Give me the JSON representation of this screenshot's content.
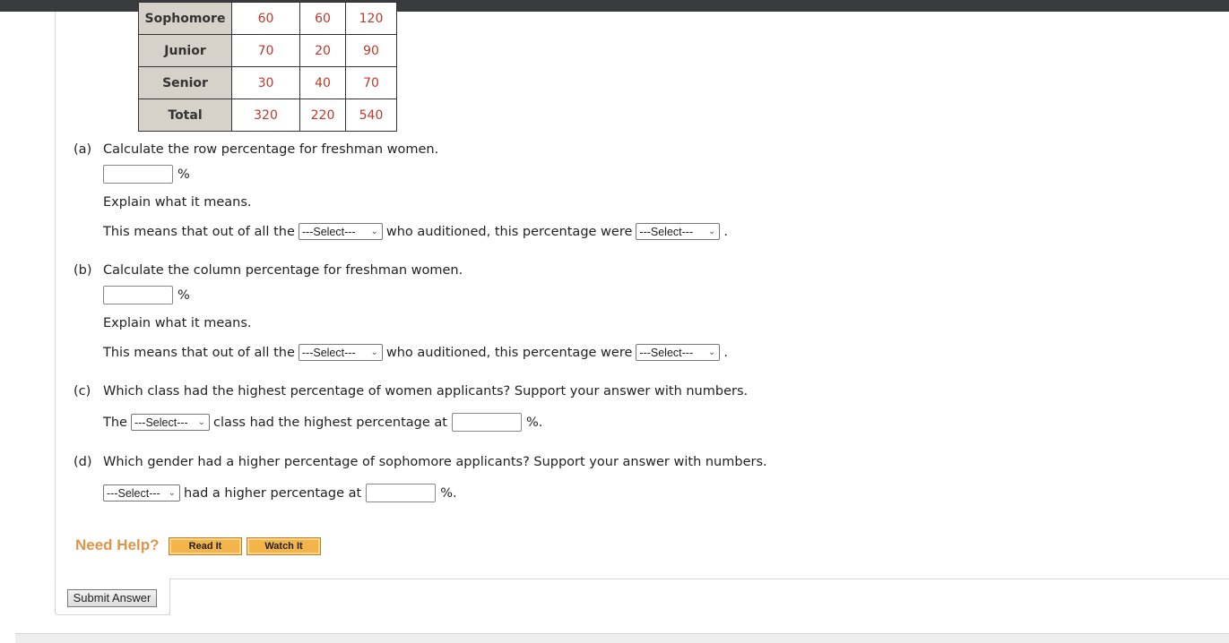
{
  "table": {
    "rows": [
      {
        "label": "Sophomore",
        "values": [
          "60",
          "60",
          "120"
        ]
      },
      {
        "label": "Junior",
        "values": [
          "70",
          "20",
          "90"
        ]
      },
      {
        "label": "Senior",
        "values": [
          "30",
          "40",
          "70"
        ]
      },
      {
        "label": "Total",
        "values": [
          "320",
          "220",
          "540"
        ]
      }
    ]
  },
  "parts": {
    "a": {
      "label": "(a)",
      "question": "Calculate the row percentage for freshman women.",
      "answer_value": "",
      "unit": "%",
      "explain": "Explain what it means.",
      "sentence_1": "This means that out of all the",
      "select_1": "---Select---",
      "sentence_2": "who auditioned, this percentage were",
      "select_2": "---Select---",
      "end": "."
    },
    "b": {
      "label": "(b)",
      "question": "Calculate the column percentage for freshman women.",
      "answer_value": "",
      "unit": "%",
      "explain": "Explain what it means.",
      "sentence_1": "This means that out of all the",
      "select_1": "---Select---",
      "sentence_2": "who auditioned, this percentage were",
      "select_2": "---Select---",
      "end": "."
    },
    "c": {
      "label": "(c)",
      "question": "Which class had the highest percentage of women applicants? Support your answer with numbers.",
      "prefix": "The",
      "select": "---Select---",
      "middle": "class had the highest percentage at",
      "answer_value": "",
      "unit": "%."
    },
    "d": {
      "label": "(d)",
      "question": "Which gender had a higher percentage of sophomore applicants? Support your answer with numbers.",
      "select": "---Select---",
      "middle": "had a higher percentage at",
      "answer_value": "",
      "unit": "%."
    }
  },
  "help": {
    "label": "Need Help?",
    "read_it": "Read It",
    "watch_it": "Watch It"
  },
  "submit_label": "Submit Answer",
  "colors": {
    "data_value": "#c0392b",
    "row_header_bg": "#d6d2c9",
    "need_help": "#e0954a",
    "help_button": "#f3b54a"
  }
}
